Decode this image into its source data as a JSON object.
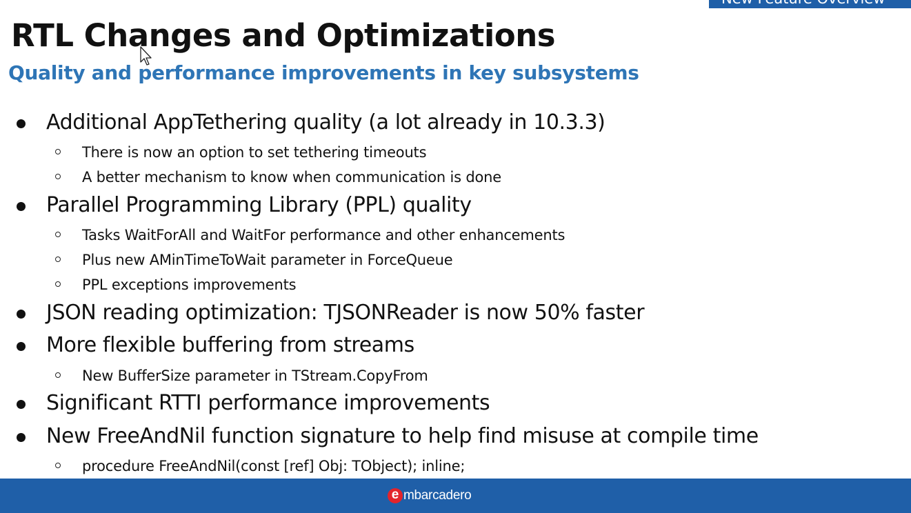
{
  "top_tab": {
    "label": "New Feature Overview"
  },
  "slide": {
    "title": "RTL Changes and Optimizations",
    "subtitle": "Quality and performance improvements in key subsystems",
    "bullets": [
      {
        "text": "Additional AppTethering quality (a lot already in 10.3.3)",
        "sub": [
          "There is now an option to set tethering timeouts",
          "A better mechanism to know when communication is done"
        ]
      },
      {
        "text": "Parallel Programming Library (PPL) quality",
        "sub": [
          "Tasks WaitForAll and WaitFor performance and other enhancements",
          "Plus new AMinTimeToWait parameter in ForceQueue",
          "PPL exceptions improvements"
        ]
      },
      {
        "text": "JSON reading optimization: TJSONReader is now 50% faster",
        "sub": []
      },
      {
        "text": "More flexible buffering from streams",
        "sub": [
          "New BufferSize parameter in TStream.CopyFrom"
        ]
      },
      {
        "text": "Significant RTTI performance improvements",
        "sub": []
      },
      {
        "text": "New FreeAndNil function signature to help find misuse at compile time",
        "sub": [
          "procedure FreeAndNil(const [ref] Obj: TObject); inline;"
        ]
      }
    ]
  },
  "footer": {
    "logo_initial": "e",
    "logo_rest": "mbarcadero"
  },
  "colors": {
    "accent_blue": "#1f5fa8",
    "subtitle_blue": "#2e75b6",
    "logo_red": "#e3242b"
  },
  "icons": {
    "cursor": "mouse-pointer-icon",
    "bullet_l1": "filled-circle-bullet",
    "bullet_l2": "hollow-circle-bullet"
  }
}
